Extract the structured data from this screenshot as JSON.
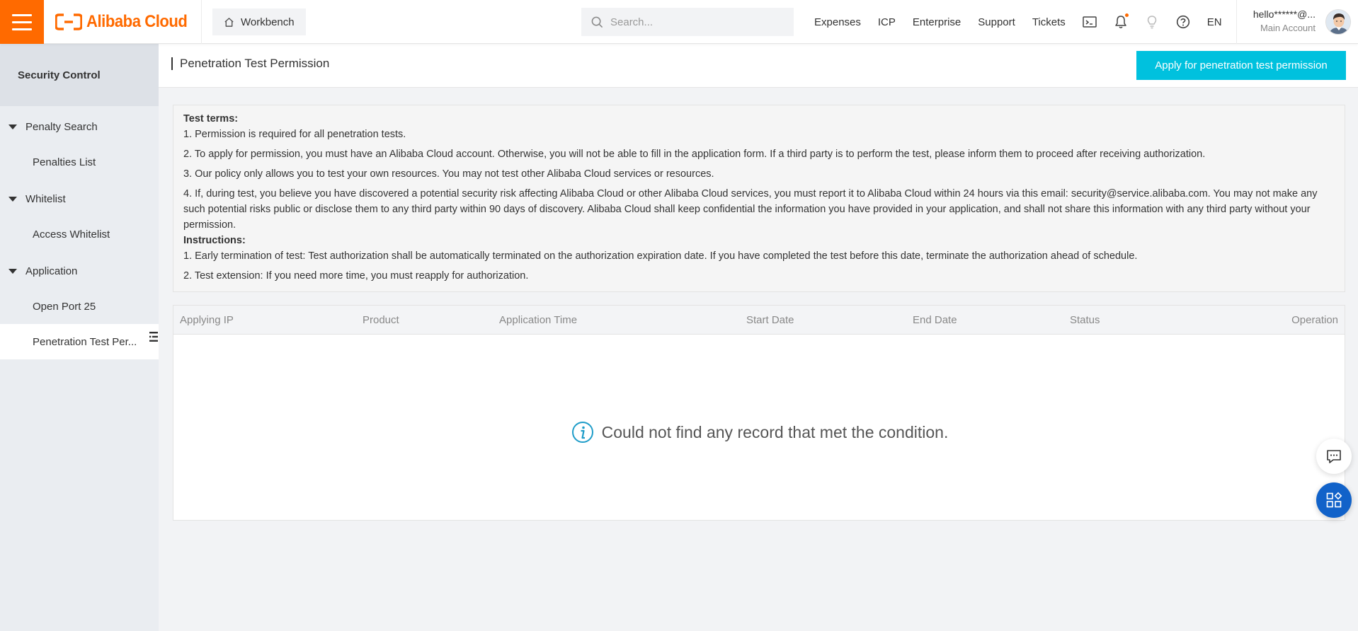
{
  "topbar": {
    "logo_text": "Alibaba Cloud",
    "workbench_label": "Workbench",
    "search_placeholder": "Search...",
    "nav_links": [
      "Expenses",
      "ICP",
      "Enterprise",
      "Support",
      "Tickets"
    ],
    "language": "EN",
    "account_name": "hello******@...",
    "account_type": "Main Account",
    "brand_color": "#ff6a00"
  },
  "sidebar": {
    "header": "Security Control",
    "groups": [
      {
        "label": "Penalty Search",
        "items": [
          "Penalties List"
        ]
      },
      {
        "label": "Whitelist",
        "items": [
          "Access Whitelist"
        ]
      },
      {
        "label": "Application",
        "items": [
          "Open Port 25",
          "Penetration Test Per..."
        ]
      }
    ],
    "active_item": "Penetration Test Per..."
  },
  "page": {
    "title": "Penetration Test Permission",
    "apply_button": "Apply for penetration test permission",
    "accent_color": "#00c1de"
  },
  "terms": {
    "heading": "Test terms:",
    "items": [
      "1. Permission is required for all penetration tests.",
      "2. To apply for permission, you must have an Alibaba Cloud account. Otherwise, you will not be able to fill in the application form. If a third party is to perform the test, please inform them to proceed after receiving authorization.",
      "3. Our policy only allows you to test your own resources. You may not test other Alibaba Cloud services or resources.",
      "4. If, during test, you believe you have discovered a potential security risk affecting Alibaba Cloud or other Alibaba Cloud services, you must report it to Alibaba Cloud within 24 hours via this email: security@service.alibaba.com. You may not make any such potential risks public or disclose them to any third party within 90 days of discovery. Alibaba Cloud shall keep confidential the information you have provided in your application, and shall not share this information with any third party without your permission."
    ],
    "instructions_heading": "Instructions:",
    "instructions": [
      "1. Early termination of test: Test authorization shall be automatically terminated on the authorization expiration date. If you have completed the test before this date, terminate the authorization ahead of schedule.",
      "2. Test extension: If you need more time, you must reapply for authorization."
    ]
  },
  "table": {
    "columns": [
      "Applying IP",
      "Product",
      "Application Time",
      "Start Date",
      "End Date",
      "Status",
      "Operation"
    ],
    "rows": [],
    "empty_message": "Could not find any record that met the condition."
  },
  "icons": {
    "hamburger": "menu-icon",
    "workbench": "home-icon",
    "search": "search-icon",
    "terminal": "terminal-icon",
    "bell": "bell-icon",
    "bulb": "lightbulb-icon",
    "help": "help-icon",
    "info": "info-icon",
    "chat": "chat-icon",
    "apps": "apps-icon"
  }
}
